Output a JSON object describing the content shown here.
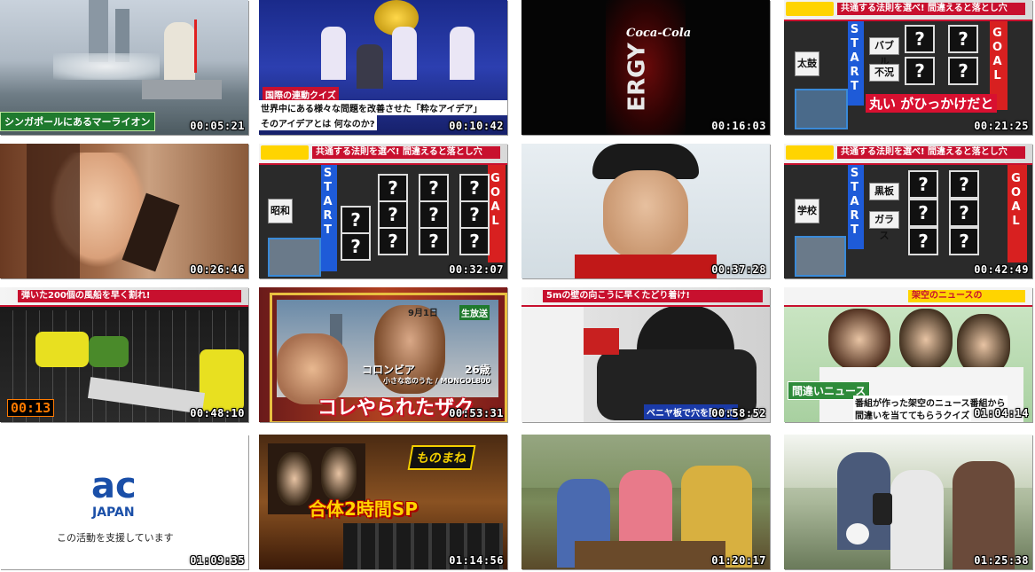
{
  "thumbnails": [
    {
      "timestamp": "00:05:21",
      "caption": "シンガポールにあるマーライオン"
    },
    {
      "timestamp": "00:10:42",
      "caption": "世界中にある様々な問題を改善させた「粋なアイデア」",
      "caption2": "そのアイデアとは 何なのか?",
      "tag": "国際の連動クイズ"
    },
    {
      "timestamp": "00:16:03",
      "brand": "Coca-Cola",
      "word": "ERGY"
    },
    {
      "timestamp": "00:21:25",
      "banner": "共通する法則を選べ! 間違えると落とし穴",
      "start": "START",
      "goal": "GOAL",
      "words": [
        "太鼓",
        "バブル",
        "不況"
      ],
      "caption": "丸い がひっかけだと"
    },
    {
      "timestamp": "00:26:46"
    },
    {
      "timestamp": "00:32:07",
      "banner": "共通する法則を選べ! 間違えると落とし穴",
      "start": "START",
      "goal": "GOAL",
      "words": [
        "昭和"
      ]
    },
    {
      "timestamp": "00:37:28"
    },
    {
      "timestamp": "00:42:49",
      "banner": "共通する法則を選べ! 間違えると落とし穴",
      "start": "START",
      "goal": "GOAL",
      "words": [
        "学校",
        "黒板",
        "ガラス"
      ]
    },
    {
      "timestamp": "00:48:10",
      "banner": "弾いた200個の風船を早く割れ!",
      "timer": "00:13"
    },
    {
      "timestamp": "00:53:31",
      "caption": "コレやられたザク",
      "sub": "コロンビア",
      "age": "26歳",
      "sub2": "小さな恋のうた / MONGOL800",
      "date": "9月1日",
      "tag": "生放送"
    },
    {
      "timestamp": "00:58:52",
      "banner": "5mの壁の向こうに早くたどり着け!",
      "caption": "ベニヤ板で穴を開けて"
    },
    {
      "timestamp": "01:04:14",
      "tag": "間違いニュース",
      "caption": "番組が作った架空のニュース番組から",
      "caption2": "間違いを当ててもらうクイズ",
      "banner": "架空のニュースの"
    },
    {
      "timestamp": "01:09:35",
      "logo_top": "ac",
      "logo_bottom": "JAPAN",
      "text": "この活動を支援しています"
    },
    {
      "timestamp": "01:14:56",
      "caption": "合体2時間SP",
      "logo": "ものまね"
    },
    {
      "timestamp": "01:20:17"
    },
    {
      "timestamp": "01:25:38"
    }
  ],
  "colors": {
    "accent_red": "#c8102e",
    "yellow": "#ffd400",
    "green": "#2e8b3a"
  }
}
